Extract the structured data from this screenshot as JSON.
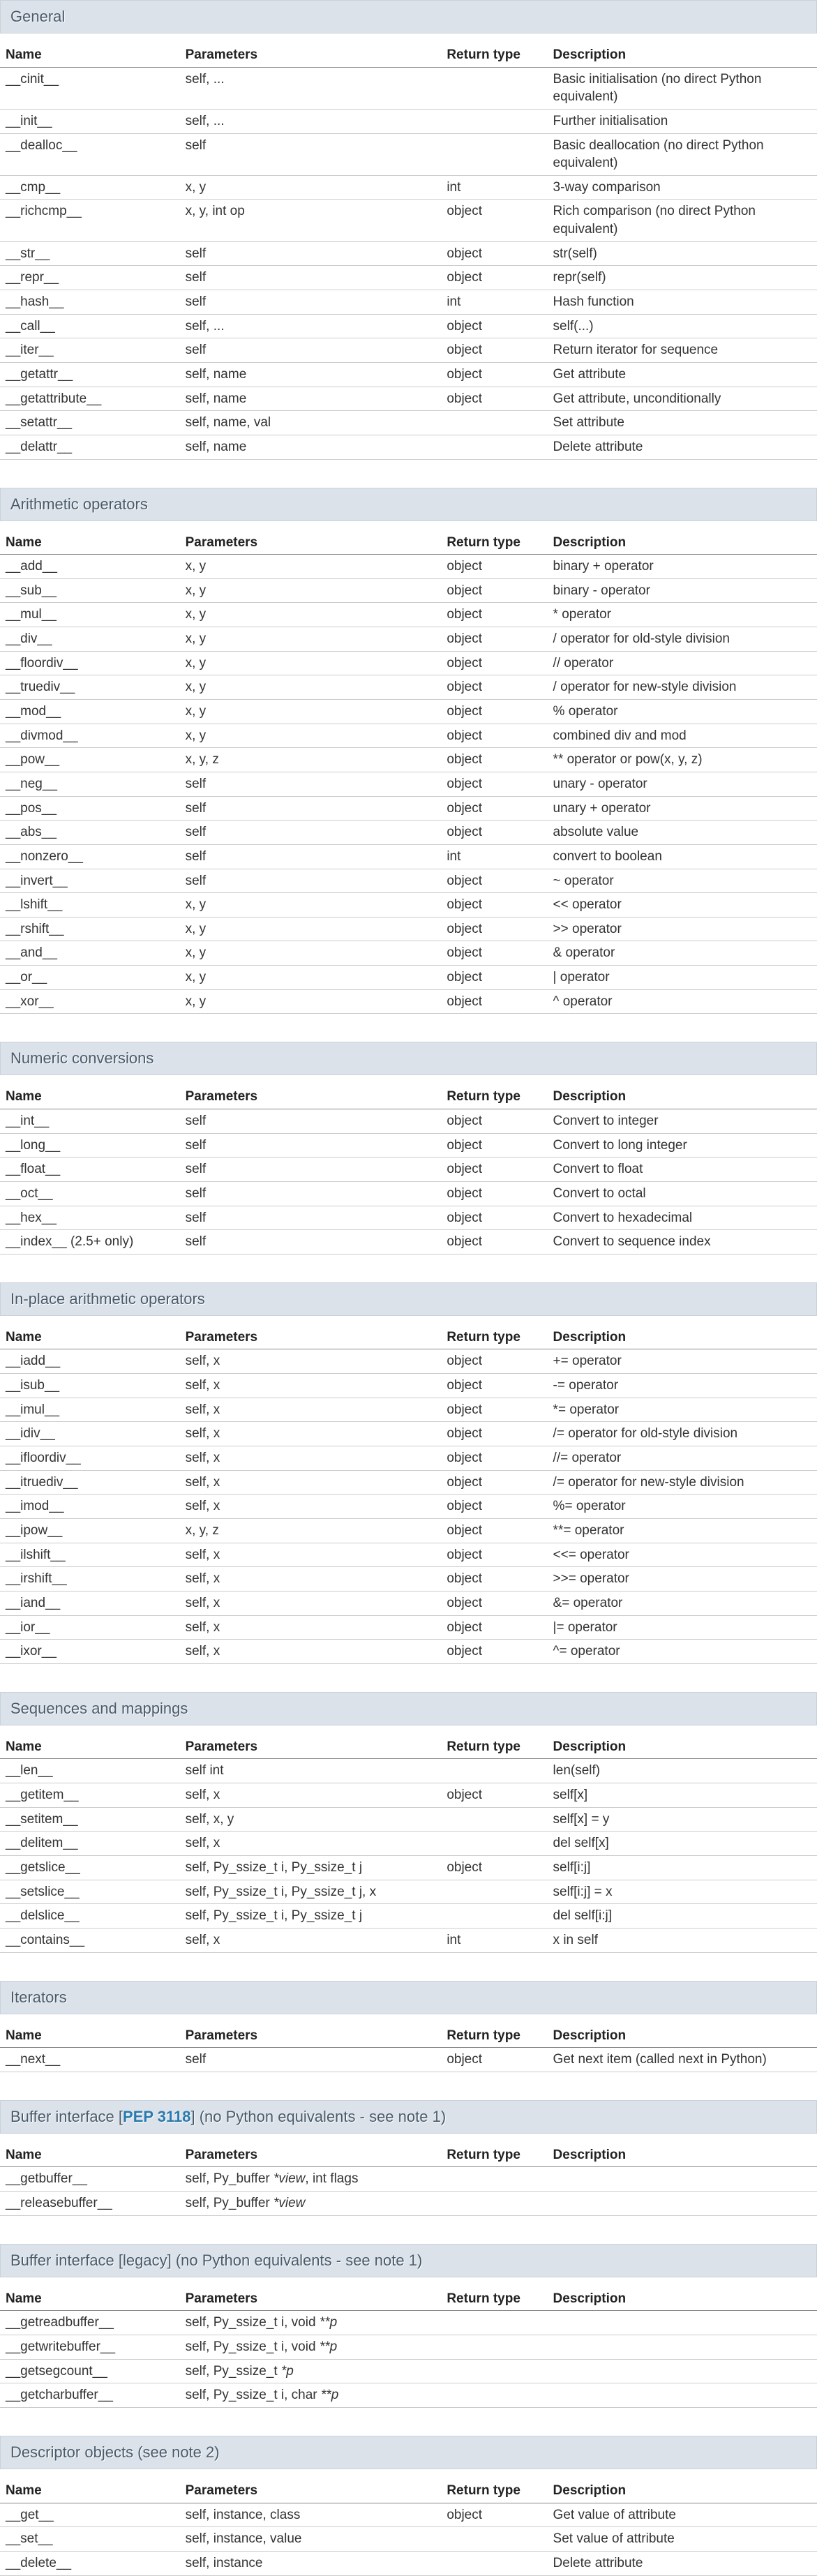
{
  "columns": [
    "Name",
    "Parameters",
    "Return type",
    "Description"
  ],
  "sections": [
    {
      "title": "General",
      "rows": [
        {
          "name": "__cinit__",
          "params": "self, ...",
          "ret": "",
          "desc": "Basic initialisation (no direct Python equivalent)"
        },
        {
          "name": "__init__",
          "params": "self, ...",
          "ret": "",
          "desc": "Further initialisation"
        },
        {
          "name": "__dealloc__",
          "params": "self",
          "ret": "",
          "desc": "Basic deallocation (no direct Python equivalent)"
        },
        {
          "name": "__cmp__",
          "params": "x, y",
          "ret": "int",
          "desc": "3-way comparison"
        },
        {
          "name": "__richcmp__",
          "params": "x, y, int op",
          "ret": "object",
          "desc": "Rich comparison (no direct Python equivalent)"
        },
        {
          "name": "__str__",
          "params": "self",
          "ret": "object",
          "desc": "str(self)"
        },
        {
          "name": "__repr__",
          "params": "self",
          "ret": "object",
          "desc": "repr(self)"
        },
        {
          "name": "__hash__",
          "params": "self",
          "ret": "int",
          "desc": "Hash function"
        },
        {
          "name": "__call__",
          "params": "self, ...",
          "ret": "object",
          "desc": "self(...)"
        },
        {
          "name": "__iter__",
          "params": "self",
          "ret": "object",
          "desc": "Return iterator for sequence"
        },
        {
          "name": "__getattr__",
          "params": "self, name",
          "ret": "object",
          "desc": "Get attribute"
        },
        {
          "name": "__getattribute__",
          "params": "self, name",
          "ret": "object",
          "desc": "Get attribute, unconditionally"
        },
        {
          "name": "__setattr__",
          "params": "self, name, val",
          "ret": "",
          "desc": "Set attribute"
        },
        {
          "name": "__delattr__",
          "params": "self, name",
          "ret": "",
          "desc": "Delete attribute"
        }
      ]
    },
    {
      "title": "Arithmetic operators",
      "rows": [
        {
          "name": "__add__",
          "params": "x, y",
          "ret": "object",
          "desc": "binary + operator"
        },
        {
          "name": "__sub__",
          "params": "x, y",
          "ret": "object",
          "desc": "binary - operator"
        },
        {
          "name": "__mul__",
          "params": "x, y",
          "ret": "object",
          "desc": "* operator"
        },
        {
          "name": "__div__",
          "params": "x, y",
          "ret": "object",
          "desc": "/ operator for old-style division"
        },
        {
          "name": "__floordiv__",
          "params": "x, y",
          "ret": "object",
          "desc": "// operator"
        },
        {
          "name": "__truediv__",
          "params": "x, y",
          "ret": "object",
          "desc": "/ operator for new-style division"
        },
        {
          "name": "__mod__",
          "params": "x, y",
          "ret": "object",
          "desc": "% operator"
        },
        {
          "name": "__divmod__",
          "params": "x, y",
          "ret": "object",
          "desc": "combined div and mod"
        },
        {
          "name": "__pow__",
          "params": "x, y, z",
          "ret": "object",
          "desc": "** operator or pow(x, y, z)"
        },
        {
          "name": "__neg__",
          "params": "self",
          "ret": "object",
          "desc": "unary - operator"
        },
        {
          "name": "__pos__",
          "params": "self",
          "ret": "object",
          "desc": "unary + operator"
        },
        {
          "name": "__abs__",
          "params": "self",
          "ret": "object",
          "desc": "absolute value"
        },
        {
          "name": "__nonzero__",
          "params": "self",
          "ret": "int",
          "desc": "convert to boolean"
        },
        {
          "name": "__invert__",
          "params": "self",
          "ret": "object",
          "desc": "~ operator"
        },
        {
          "name": "__lshift__",
          "params": "x, y",
          "ret": "object",
          "desc": "<< operator"
        },
        {
          "name": "__rshift__",
          "params": "x, y",
          "ret": "object",
          "desc": ">> operator"
        },
        {
          "name": "__and__",
          "params": "x, y",
          "ret": "object",
          "desc": "& operator"
        },
        {
          "name": "__or__",
          "params": "x, y",
          "ret": "object",
          "desc": "| operator"
        },
        {
          "name": "__xor__",
          "params": "x, y",
          "ret": "object",
          "desc": "^ operator"
        }
      ]
    },
    {
      "title": "Numeric conversions",
      "rows": [
        {
          "name": "__int__",
          "params": "self",
          "ret": "object",
          "desc": "Convert to integer"
        },
        {
          "name": "__long__",
          "params": "self",
          "ret": "object",
          "desc": "Convert to long integer"
        },
        {
          "name": "__float__",
          "params": "self",
          "ret": "object",
          "desc": "Convert to float"
        },
        {
          "name": "__oct__",
          "params": "self",
          "ret": "object",
          "desc": "Convert to octal"
        },
        {
          "name": "__hex__",
          "params": "self",
          "ret": "object",
          "desc": "Convert to hexadecimal"
        },
        {
          "name": "__index__ (2.5+ only)",
          "params": "self",
          "ret": "object",
          "desc": "Convert to sequence index"
        }
      ]
    },
    {
      "title": "In-place arithmetic operators",
      "rows": [
        {
          "name": "__iadd__",
          "params": "self, x",
          "ret": "object",
          "desc": "+= operator"
        },
        {
          "name": "__isub__",
          "params": "self, x",
          "ret": "object",
          "desc": "-= operator"
        },
        {
          "name": "__imul__",
          "params": "self, x",
          "ret": "object",
          "desc": "*= operator"
        },
        {
          "name": "__idiv__",
          "params": "self, x",
          "ret": "object",
          "desc": "/= operator for old-style division"
        },
        {
          "name": "__ifloordiv__",
          "params": "self, x",
          "ret": "object",
          "desc": "//= operator"
        },
        {
          "name": "__itruediv__",
          "params": "self, x",
          "ret": "object",
          "desc": "/= operator for new-style division"
        },
        {
          "name": "__imod__",
          "params": "self, x",
          "ret": "object",
          "desc": "%= operator"
        },
        {
          "name": "__ipow__",
          "params": "x, y, z",
          "ret": "object",
          "desc": "**= operator"
        },
        {
          "name": "__ilshift__",
          "params": "self, x",
          "ret": "object",
          "desc": "<<= operator"
        },
        {
          "name": "__irshift__",
          "params": "self, x",
          "ret": "object",
          "desc": ">>= operator"
        },
        {
          "name": "__iand__",
          "params": "self, x",
          "ret": "object",
          "desc": "&= operator"
        },
        {
          "name": "__ior__",
          "params": "self, x",
          "ret": "object",
          "desc": "|= operator"
        },
        {
          "name": "__ixor__",
          "params": "self, x",
          "ret": "object",
          "desc": "^= operator"
        }
      ]
    },
    {
      "title": "Sequences and mappings",
      "rows": [
        {
          "name": "__len__",
          "params": "self int",
          "ret": "",
          "desc": "len(self)"
        },
        {
          "name": "__getitem__",
          "params": "self, x",
          "ret": "object",
          "desc": "self[x]"
        },
        {
          "name": "__setitem__",
          "params": "self, x, y",
          "ret": "",
          "desc": "self[x] = y"
        },
        {
          "name": "__delitem__",
          "params": "self, x",
          "ret": "",
          "desc": "del self[x]"
        },
        {
          "name": "__getslice__",
          "params": "self, Py_ssize_t i, Py_ssize_t j",
          "ret": "object",
          "desc": "self[i:j]"
        },
        {
          "name": "__setslice__",
          "params": "self, Py_ssize_t i, Py_ssize_t j, x",
          "ret": "",
          "desc": "self[i:j] = x"
        },
        {
          "name": "__delslice__",
          "params": "self, Py_ssize_t i, Py_ssize_t j",
          "ret": "",
          "desc": "del self[i:j]"
        },
        {
          "name": "__contains__",
          "params": "self, x",
          "ret": "int",
          "desc": "x in self"
        }
      ]
    },
    {
      "title": "Iterators",
      "rows": [
        {
          "name": "__next__",
          "params": "self",
          "ret": "object",
          "desc": "Get next item (called next in Python)"
        }
      ]
    },
    {
      "title_pre": "Buffer interface [",
      "title_link": "PEP 3118",
      "title_post": "] (no Python equivalents - see note 1)",
      "rows": [
        {
          "name": "__getbuffer__",
          "params_html": "self, Py_buffer <span class=\"ital\">*view</span>, int flags",
          "ret": "",
          "desc": ""
        },
        {
          "name": "__releasebuffer__",
          "params_html": "self, Py_buffer <span class=\"ital\">*view</span>",
          "ret": "",
          "desc": ""
        }
      ]
    },
    {
      "title": "Buffer interface [legacy] (no Python equivalents - see note 1)",
      "rows": [
        {
          "name": "__getreadbuffer__",
          "params_html": "self, Py_ssize_t i, void <span class=\"ital\">**p</span>",
          "ret": "",
          "desc": ""
        },
        {
          "name": "__getwritebuffer__",
          "params_html": "self, Py_ssize_t i, void <span class=\"ital\">**p</span>",
          "ret": "",
          "desc": ""
        },
        {
          "name": "__getsegcount__",
          "params_html": "self, Py_ssize_t <span class=\"ital\">*p</span>",
          "ret": "",
          "desc": ""
        },
        {
          "name": "__getcharbuffer__",
          "params_html": "self, Py_ssize_t i, char <span class=\"ital\">**p</span>",
          "ret": "",
          "desc": ""
        }
      ]
    },
    {
      "title": "Descriptor objects (see note 2)",
      "rows": [
        {
          "name": "__get__",
          "params": "self, instance, class",
          "ret": "object",
          "desc": "Get value of attribute"
        },
        {
          "name": "__set__",
          "params": "self, instance, value",
          "ret": "",
          "desc": "Set value of attribute"
        },
        {
          "name": "__delete__",
          "params": "self, instance",
          "ret": "",
          "desc": "Delete attribute"
        }
      ]
    }
  ]
}
